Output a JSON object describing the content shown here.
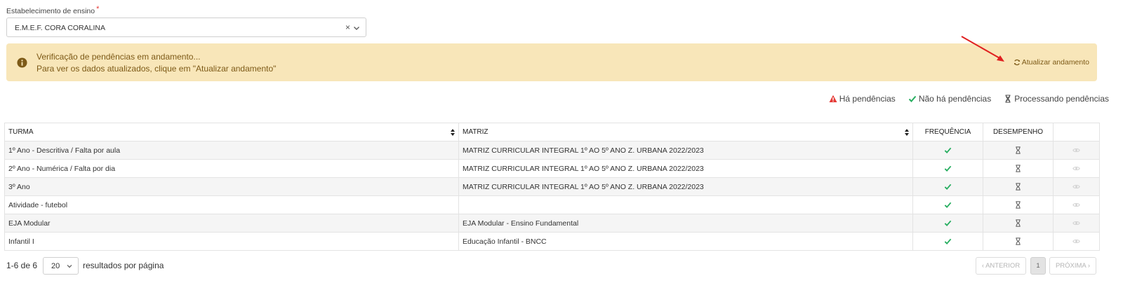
{
  "form": {
    "label": "Estabelecimento de ensino",
    "required_mark": "*",
    "selected": "E.M.E.F. CORA CORALINA",
    "clear_glyph": "×"
  },
  "alert": {
    "line1": "Verificação de pendências em andamento...",
    "line2": "Para ver os dados atualizados, clique em \"Atualizar andamento\"",
    "action": "Atualizar andamento",
    "bg_color": "#f8e6b9",
    "text_color": "#7d5a17"
  },
  "legend": {
    "pending": "Há pendências",
    "none": "Não há pendências",
    "processing": "Processando pendências"
  },
  "table": {
    "headers": {
      "turma": "TURMA",
      "matriz": "MATRIZ",
      "frequencia": "FREQUÊNCIA",
      "desempenho": "DESEMPENHO"
    },
    "rows": [
      {
        "turma": "1º Ano - Descritiva / Falta por aula",
        "matriz": "MATRIZ CURRICULAR INTEGRAL 1º AO 5º ANO Z. URBANA 2022/2023",
        "frequencia": "check-icon",
        "desempenho": "hourglass-icon"
      },
      {
        "turma": "2º Ano - Numérica / Falta por dia",
        "matriz": "MATRIZ CURRICULAR INTEGRAL 1º AO 5º ANO Z. URBANA 2022/2023",
        "frequencia": "check-icon",
        "desempenho": "hourglass-icon"
      },
      {
        "turma": "3º Ano",
        "matriz": "MATRIZ CURRICULAR INTEGRAL 1º AO 5º ANO Z. URBANA 2022/2023",
        "frequencia": "check-icon",
        "desempenho": "hourglass-icon"
      },
      {
        "turma": "Atividade - futebol",
        "matriz": "",
        "frequencia": "check-icon",
        "desempenho": "hourglass-icon"
      },
      {
        "turma": "EJA Modular",
        "matriz": "EJA Modular - Ensino Fundamental",
        "frequencia": "check-icon",
        "desempenho": "hourglass-icon"
      },
      {
        "turma": "Infantil I",
        "matriz": "Educação Infantil - BNCC",
        "frequencia": "check-icon",
        "desempenho": "hourglass-icon"
      }
    ]
  },
  "footer": {
    "count": "1-6 de 6",
    "page_size": "20",
    "per_page_text": "resultados por página",
    "prev": "‹ ANTERIOR",
    "current_page": "1",
    "next": "PRÓXIMA ›"
  },
  "colors": {
    "check": "#27ae60",
    "warning": "#e53935",
    "arrow": "#e02020"
  }
}
